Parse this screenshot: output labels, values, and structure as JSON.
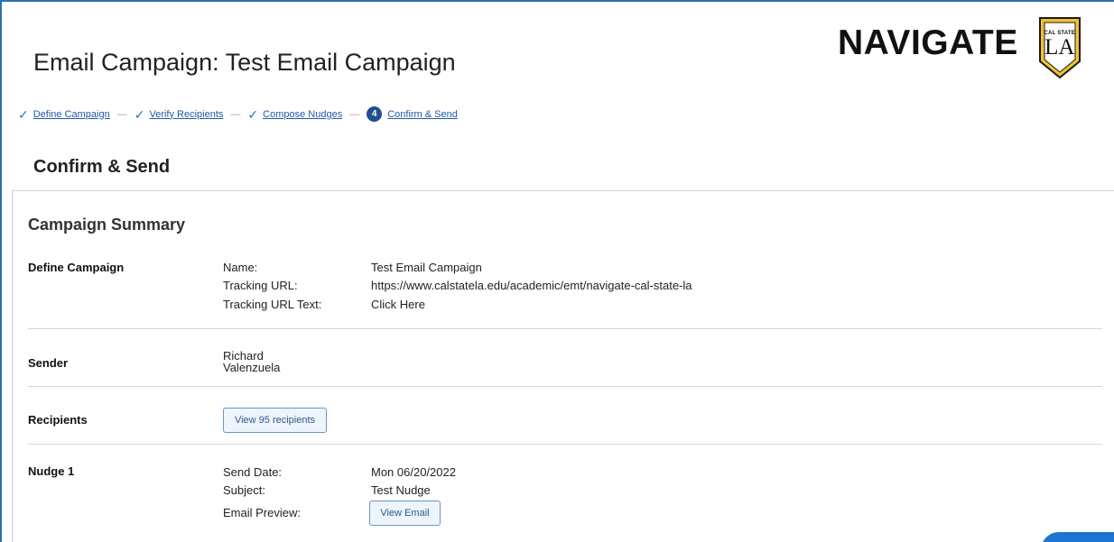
{
  "page": {
    "title": "Email Campaign: Test Email Campaign"
  },
  "brand": {
    "wordmark": "NAVIGATE",
    "badge_top": "CAL STATE",
    "badge_main": "LA"
  },
  "stepper": {
    "steps": [
      {
        "label": "Define Campaign",
        "state": "complete"
      },
      {
        "label": "Verify Recipients",
        "state": "complete"
      },
      {
        "label": "Compose Nudges",
        "state": "complete"
      },
      {
        "label": "Confirm & Send",
        "state": "current",
        "number": "4"
      }
    ],
    "separator": "—"
  },
  "section": {
    "title": "Confirm & Send"
  },
  "summary": {
    "title": "Campaign Summary",
    "define_campaign": {
      "label": "Define Campaign",
      "fields": [
        {
          "key": "Name:",
          "value": "Test Email Campaign"
        },
        {
          "key": "Tracking URL:",
          "value": "https://www.calstatela.edu/academic/emt/navigate-cal-state-la"
        },
        {
          "key": "Tracking URL Text:",
          "value": "Click Here"
        }
      ]
    },
    "sender": {
      "label": "Sender",
      "first": "Richard",
      "last": "Valenzuela"
    },
    "recipients": {
      "label": "Recipients",
      "button": "View 95 recipients"
    },
    "nudge1": {
      "label": "Nudge 1",
      "send_date_key": "Send Date:",
      "send_date_value": "Mon 06/20/2022",
      "subject_key": "Subject:",
      "subject_value": "Test Nudge",
      "preview_key": "Email Preview:",
      "preview_button": "View Email"
    }
  },
  "colors": {
    "accent": "#2f6fb2",
    "link": "#1f5aa6",
    "step_current": "#1f4f8f",
    "button_bg": "#eef4fb",
    "button_border": "#6b95c5",
    "fab": "#1f73d1"
  }
}
